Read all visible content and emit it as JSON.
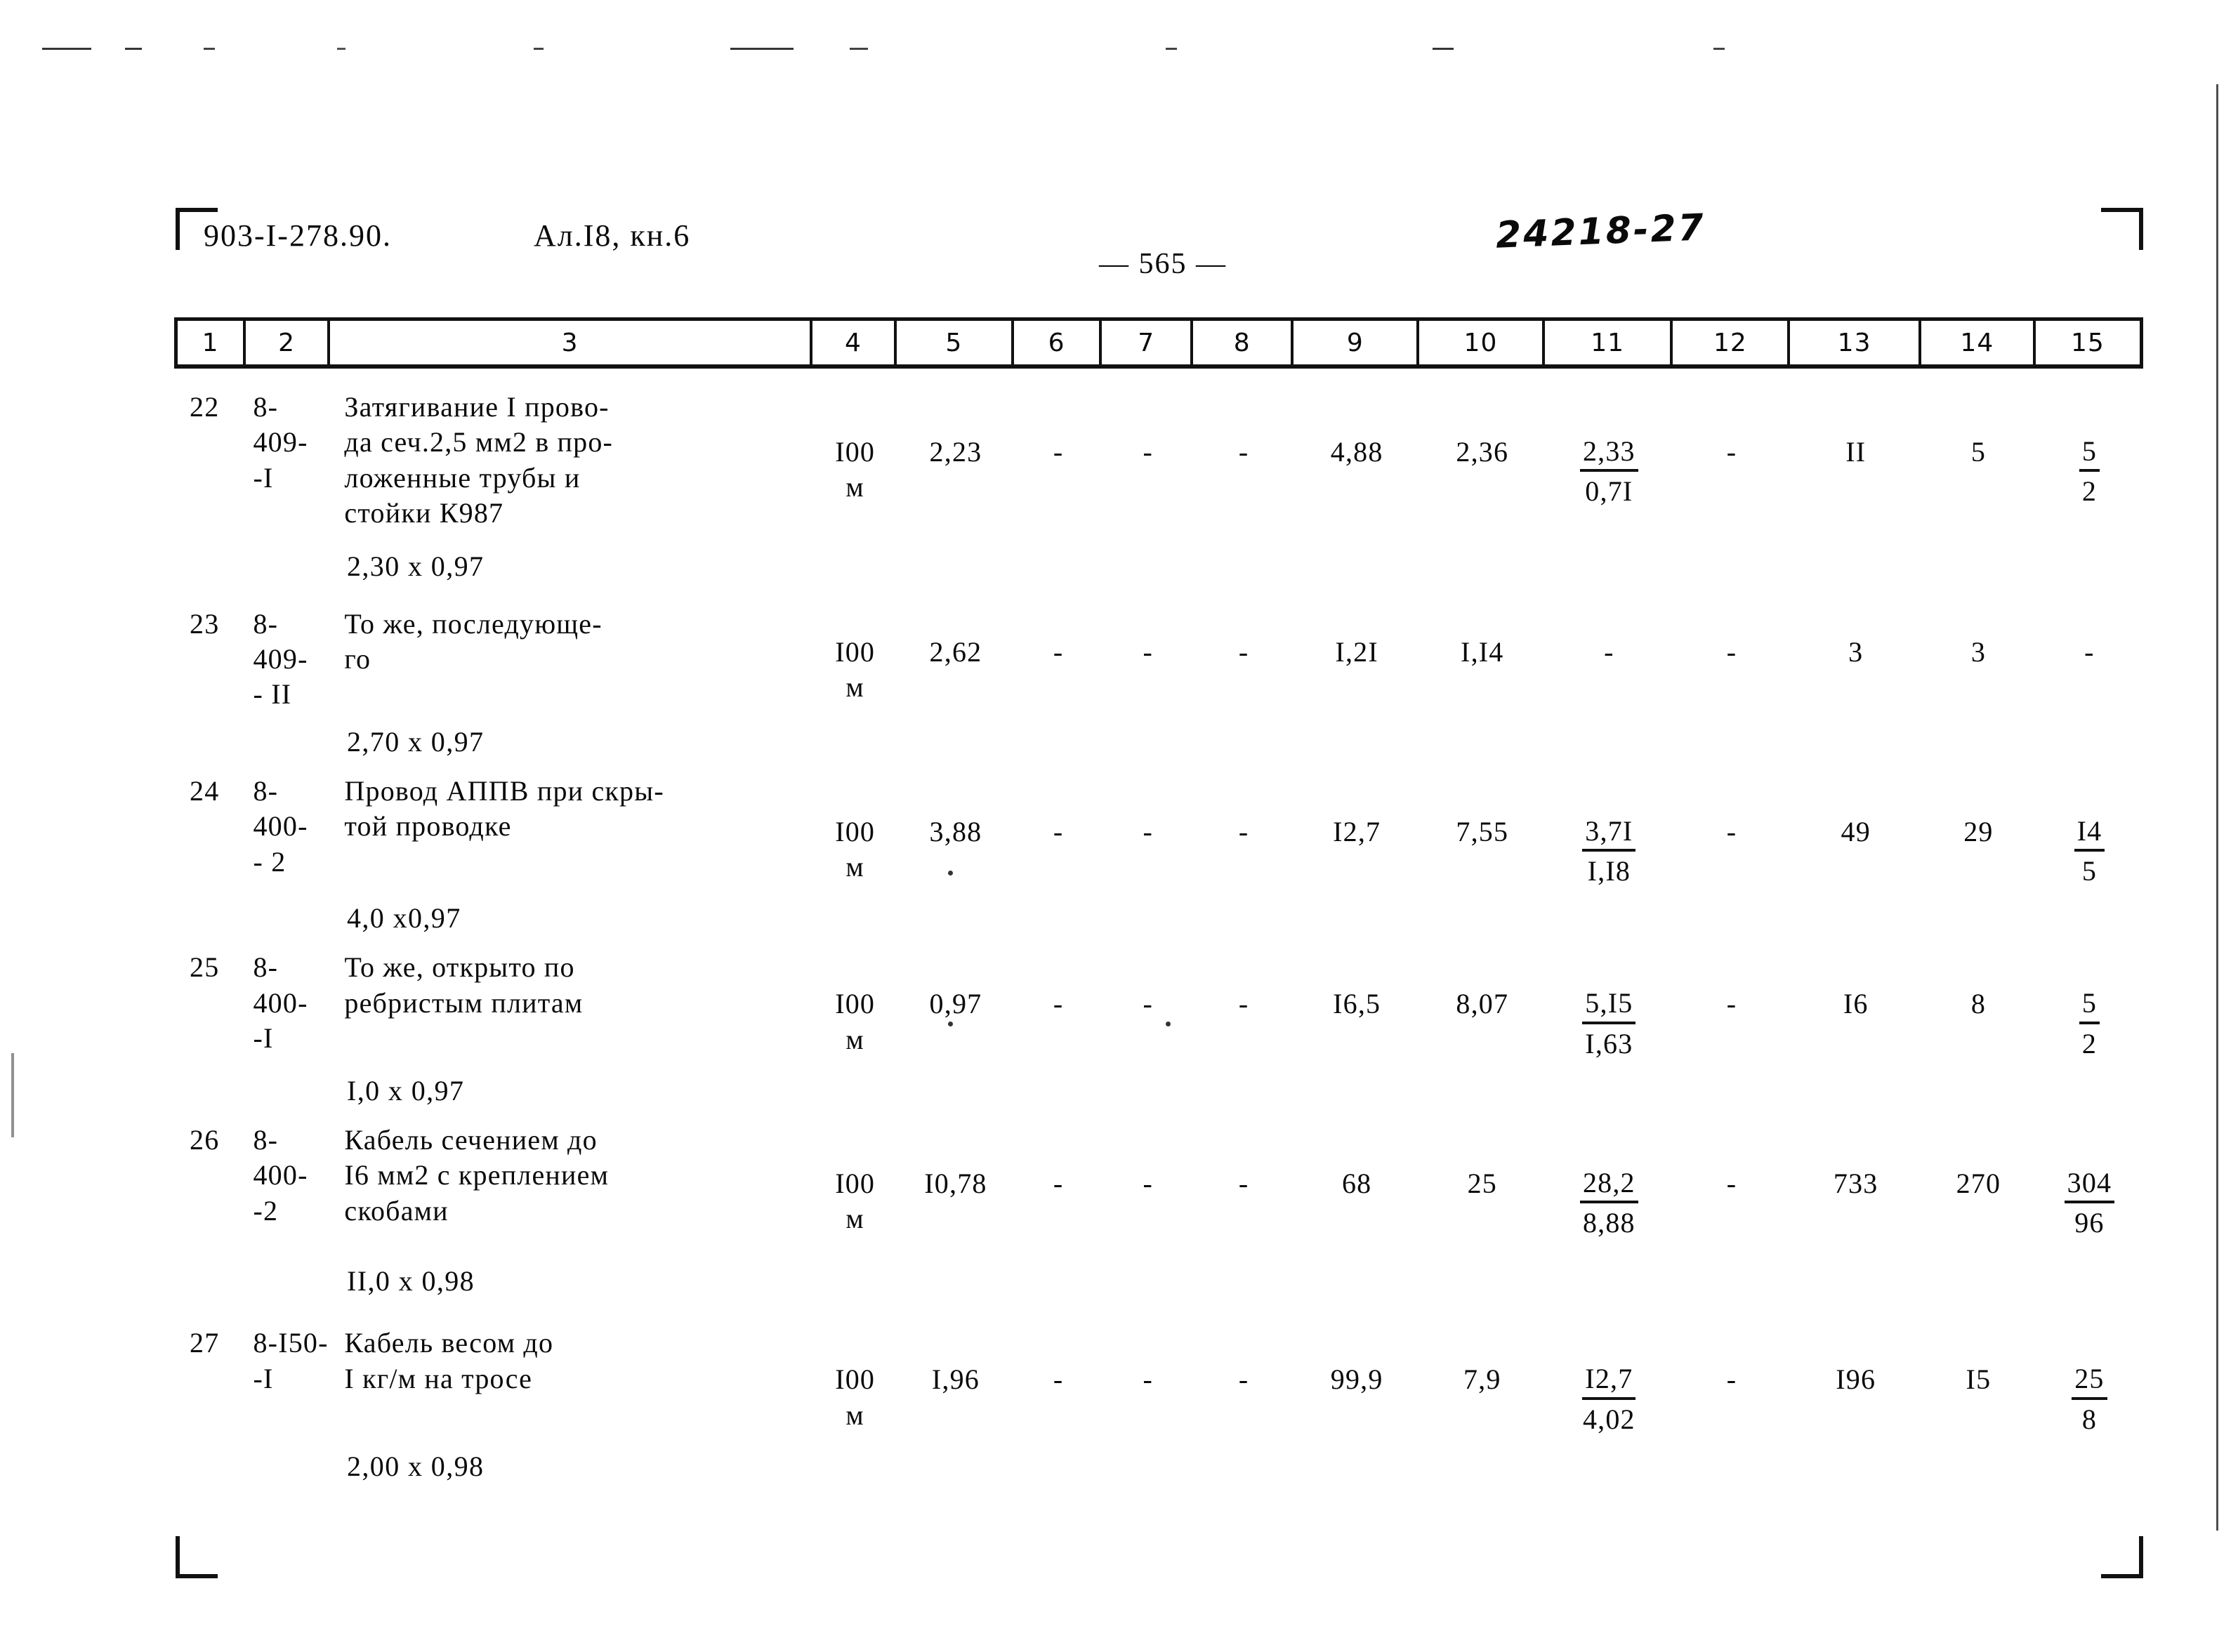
{
  "header": {
    "doc_code": "903-I-278.90.",
    "album_ref": "Ал.I8, кн.6",
    "page_number": "— 565 —",
    "stamp_code": "24218-27"
  },
  "table": {
    "column_headers": [
      "1",
      "2",
      "3",
      "4",
      "5",
      "6",
      "7",
      "8",
      "9",
      "10",
      "11",
      "12",
      "13",
      "14",
      "15"
    ],
    "rows": [
      {
        "no": "22",
        "code": "8-409-\n-I",
        "description": "Затягивание I прово-\nда сеч.2,5 мм2 в про-\nложенные трубы и\nстойки К987",
        "formula": "2,30 х 0,97",
        "unit": "I00\nм",
        "c5": "2,23",
        "c6": "-",
        "c7": "-",
        "c8": "-",
        "c9": "4,88",
        "c10": "2,36",
        "c11_top": "2,33",
        "c11_bot": "0,7I",
        "c12": "-",
        "c13": "II",
        "c14": "5",
        "c15_top": "5",
        "c15_bot": "2"
      },
      {
        "no": "23",
        "code": "8-409-\n- II",
        "description": "То же, последующе-\nго",
        "formula": "2,70 х 0,97",
        "unit": "I00\nм",
        "c5": "2,62",
        "c6": "-",
        "c7": "-",
        "c8": "-",
        "c9": "I,2I",
        "c10": "I,I4",
        "c11_top": "-",
        "c11_bot": "",
        "c12": "-",
        "c13": "3",
        "c14": "3",
        "c15_top": "-",
        "c15_bot": ""
      },
      {
        "no": "24",
        "code": "8-400-\n- 2",
        "description": "Провод АППВ при скры-\nтой проводке",
        "formula": "4,0 х0,97",
        "unit": "I00\nм",
        "c5": "3,88",
        "c6": "-",
        "c7": "-",
        "c8": "-",
        "c9": "I2,7",
        "c10": "7,55",
        "c11_top": "3,7I",
        "c11_bot": "I,I8",
        "c12": "-",
        "c13": "49",
        "c14": "29",
        "c15_top": "I4",
        "c15_bot": "5"
      },
      {
        "no": "25",
        "code": "8-400-\n-I",
        "description": "То же, открыто по\nребристым плитам",
        "formula": "I,0 х 0,97",
        "unit": "I00\nм",
        "c5": "0,97",
        "c6": "-",
        "c7": "-",
        "c8": "-",
        "c9": "I6,5",
        "c10": "8,07",
        "c11_top": "5,I5",
        "c11_bot": "I,63",
        "c12": "-",
        "c13": "I6",
        "c14": "8",
        "c15_top": "5",
        "c15_bot": "2"
      },
      {
        "no": "26",
        "code": "8-400-\n-2",
        "description": "Кабель сечением до\nI6 мм2 с креплением\nскобами",
        "formula": "II,0 х 0,98",
        "unit": "I00\nм",
        "c5": "I0,78",
        "c6": "-",
        "c7": "-",
        "c8": "-",
        "c9": "68",
        "c10": "25",
        "c11_top": "28,2",
        "c11_bot": "8,88",
        "c12": "-",
        "c13": "733",
        "c14": "270",
        "c15_top": "304",
        "c15_bot": "96"
      },
      {
        "no": "27",
        "code": "8-I50-\n-I",
        "description": "Кабель весом до\nI кг/м на тросе",
        "formula": "2,00 х 0,98",
        "unit": "I00\nм",
        "c5": "I,96",
        "c6": "-",
        "c7": "-",
        "c8": "-",
        "c9": "99,9",
        "c10": "7,9",
        "c11_top": "I2,7",
        "c11_bot": "4,02",
        "c12": "-",
        "c13": "I96",
        "c14": "I5",
        "c15_top": "25",
        "c15_bot": "8"
      }
    ]
  }
}
